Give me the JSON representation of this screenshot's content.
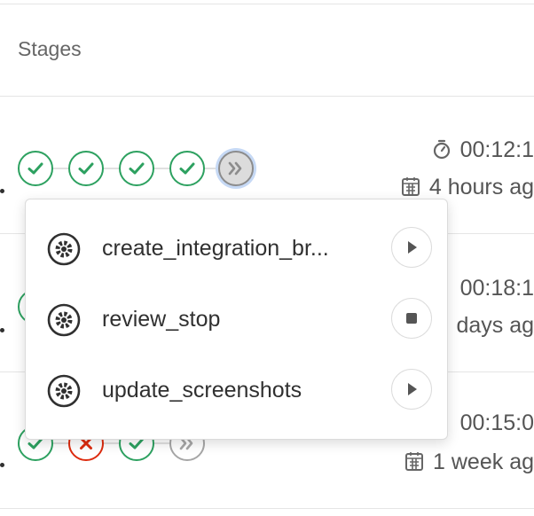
{
  "table": {
    "stages_header": "Stages"
  },
  "pipelines": [
    {
      "stages": [
        "success",
        "success",
        "success",
        "success",
        "skipped-active"
      ],
      "duration": "00:12:1",
      "finished_ago": "4 hours ag"
    },
    {
      "stages": [
        "success"
      ],
      "duration": "00:18:1",
      "finished_ago": "days ag"
    },
    {
      "stages": [
        "success",
        "failed",
        "success",
        "skipped"
      ],
      "duration": "00:15:0",
      "finished_ago": "1 week ag"
    }
  ],
  "dropdown": {
    "jobs": [
      {
        "name": "create_integration_br...",
        "action": "play"
      },
      {
        "name": "review_stop",
        "action": "stop"
      },
      {
        "name": "update_screenshots",
        "action": "play"
      }
    ]
  },
  "icons": {
    "success": "check-circle-icon",
    "failed": "x-circle-icon",
    "skipped": "double-chevron-right-icon",
    "gear": "gear-icon",
    "timer": "stopwatch-icon",
    "calendar": "calendar-icon",
    "play": "play-icon",
    "stop": "stop-icon"
  },
  "colors": {
    "success": "#2da160",
    "failed": "#dd2b0e",
    "skipped": "#a6a6a6",
    "text_muted": "#666666"
  }
}
